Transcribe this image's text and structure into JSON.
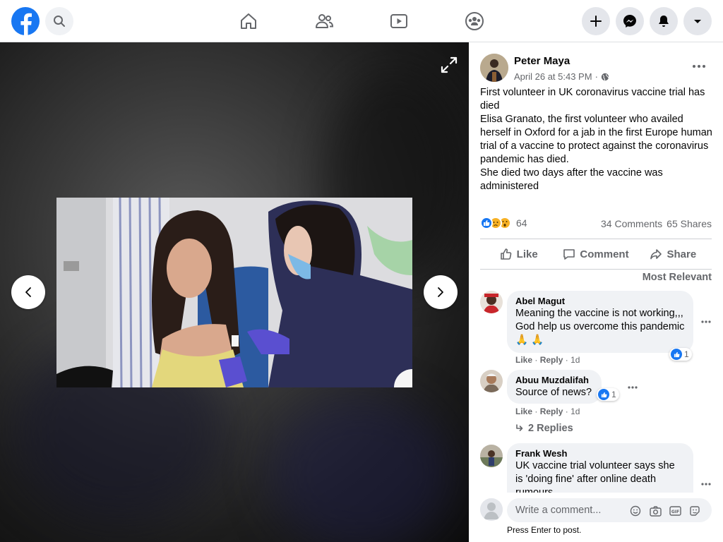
{
  "topbar": {
    "icons": [
      "facebook-logo-icon",
      "search-icon",
      "home-icon",
      "friends-icon",
      "watch-icon",
      "groups-icon",
      "plus-icon",
      "messenger-icon",
      "notifications-icon",
      "account-menu-icon"
    ],
    "brand_color": "#1877f2"
  },
  "viewer": {
    "icons": [
      "expand-icon",
      "previous-arrow-icon",
      "next-arrow-icon"
    ]
  },
  "post": {
    "author": "Peter Maya",
    "timestamp": "April 26 at 5:43 PM",
    "separator": "·",
    "audience_icon": "globe-icon",
    "text_lines": [
      "First volunteer in UK coronavirus vaccine trial has died",
      "Elisa Granato, the first volunteer who availed herself in Oxford for a jab in the first Europe human trial of a vaccine to protect against the coronavirus pandemic has died.",
      "She died two days after the vaccine was administered"
    ],
    "reactions": {
      "icons": [
        "like-reaction-icon",
        "sad-reaction-icon",
        "wow-reaction-icon"
      ],
      "count": "64"
    },
    "comments_count": "34 Comments",
    "shares_count": "65 Shares",
    "actions": {
      "like": "Like",
      "comment": "Comment",
      "share": "Share"
    },
    "sort_label": "Most Relevant"
  },
  "comments": [
    {
      "name": "Abel Magut",
      "text": "Meaning the vaccine is not working,,, God help us overcome this pandemic 🙏 🙏",
      "like": "Like",
      "reply": "Reply",
      "dot": "·",
      "time": "1d",
      "reaction_count": "1"
    },
    {
      "name": "Abuu Muzdalifah",
      "text": "Source of news?",
      "like": "Like",
      "reply": "Reply",
      "dot": "·",
      "time": "1d",
      "reaction_count": "1"
    },
    {
      "name": "Frank Wesh",
      "text": "UK vaccine trial volunteer says she is 'doing fine' after online death rumours"
    }
  ],
  "replies_link": "2 Replies",
  "composer": {
    "placeholder": "Write a comment...",
    "hint": "Press Enter to post.",
    "icons": [
      "emoji-icon",
      "camera-icon",
      "gif-icon",
      "sticker-icon"
    ]
  }
}
